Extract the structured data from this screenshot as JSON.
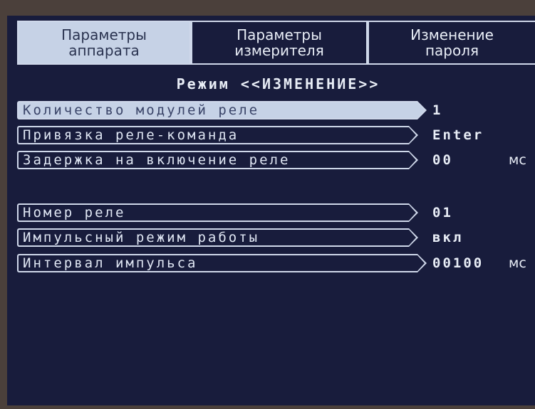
{
  "tabs": [
    {
      "line1": "Параметры",
      "line2": "аппарата",
      "active": true
    },
    {
      "line1": "Параметры",
      "line2": "измерителя",
      "active": false
    },
    {
      "line1": "Изменение",
      "line2": "пароля",
      "active": false
    }
  ],
  "mode_title": "Режим <<ИЗМЕНЕНИЕ>>",
  "rows": [
    {
      "label": "Количество модулей реле",
      "value": "1",
      "unit": ""
    },
    {
      "label": "Привязка реле-команда",
      "value": "Enter",
      "unit": ""
    },
    {
      "label": "Задержка на включение реле",
      "value": "00",
      "unit": "мс"
    },
    {
      "label": "Номер реле",
      "value": "01",
      "unit": ""
    },
    {
      "label": "Импульсный режим работы",
      "value": "вкл",
      "unit": ""
    },
    {
      "label": "Интервал импульса",
      "value": "00100",
      "unit": "мс"
    }
  ],
  "colors": {
    "screen_bg": "#181c3c",
    "highlight": "#c6d2e6",
    "border": "#cfd8ea"
  }
}
